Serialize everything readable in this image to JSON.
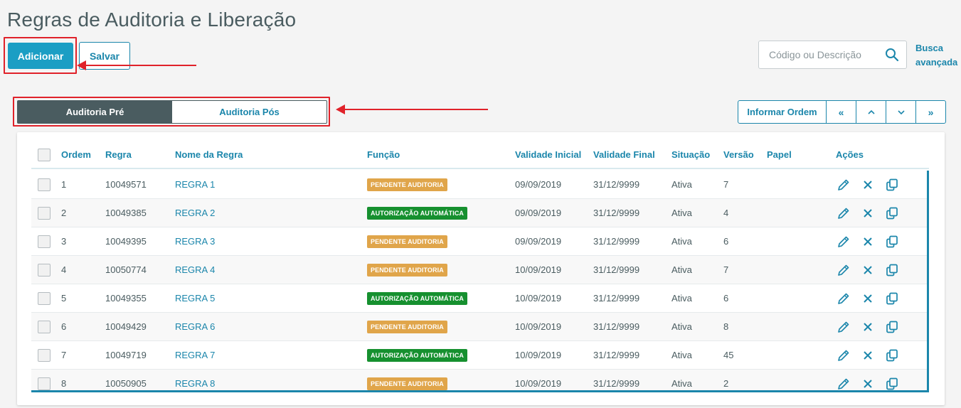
{
  "page": {
    "title": "Regras de Auditoria e Liberação"
  },
  "toolbar": {
    "add_label": "Adicionar",
    "save_label": "Salvar"
  },
  "search": {
    "placeholder": "Código ou Descrição",
    "advanced_line1": "Busca",
    "advanced_line2": "avançada"
  },
  "tabs": [
    {
      "label": "Auditoria Pré",
      "active": true
    },
    {
      "label": "Auditoria Pós",
      "active": false
    }
  ],
  "order_bar": {
    "inform_label": "Informar Ordem",
    "first": "«",
    "up": "˄",
    "down": "˅",
    "last": "»"
  },
  "table": {
    "columns": {
      "order": "Ordem",
      "rule": "Regra",
      "name": "Nome da Regra",
      "function": "Função",
      "valid_from": "Validade Inicial",
      "valid_to": "Validade Final",
      "status": "Situação",
      "version": "Versão",
      "role": "Papel",
      "actions": "Ações"
    },
    "rows": [
      {
        "order": "1",
        "rule": "10049571",
        "name": "REGRA 1",
        "function": "PENDENTE AUDITORIA",
        "kind": "orange",
        "valid_from": "09/09/2019",
        "valid_to": "31/12/9999",
        "status": "Ativa",
        "version": "7"
      },
      {
        "order": "2",
        "rule": "10049385",
        "name": "REGRA 2",
        "function": "AUTORIZAÇÃO AUTOMÁTICA",
        "kind": "green",
        "valid_from": "09/09/2019",
        "valid_to": "31/12/9999",
        "status": "Ativa",
        "version": "4"
      },
      {
        "order": "3",
        "rule": "10049395",
        "name": "REGRA 3",
        "function": "PENDENTE AUDITORIA",
        "kind": "orange",
        "valid_from": "09/09/2019",
        "valid_to": "31/12/9999",
        "status": "Ativa",
        "version": "6"
      },
      {
        "order": "4",
        "rule": "10050774",
        "name": "REGRA 4",
        "function": "PENDENTE AUDITORIA",
        "kind": "orange",
        "valid_from": "10/09/2019",
        "valid_to": "31/12/9999",
        "status": "Ativa",
        "version": "7"
      },
      {
        "order": "5",
        "rule": "10049355",
        "name": "REGRA 5",
        "function": "AUTORIZAÇÃO AUTOMÁTICA",
        "kind": "green",
        "valid_from": "10/09/2019",
        "valid_to": "31/12/9999",
        "status": "Ativa",
        "version": "6"
      },
      {
        "order": "6",
        "rule": "10049429",
        "name": "REGRA 6",
        "function": "PENDENTE AUDITORIA",
        "kind": "orange",
        "valid_from": "10/09/2019",
        "valid_to": "31/12/9999",
        "status": "Ativa",
        "version": "8"
      },
      {
        "order": "7",
        "rule": "10049719",
        "name": "REGRA 7",
        "function": "AUTORIZAÇÃO AUTOMÁTICA",
        "kind": "green",
        "valid_from": "10/09/2019",
        "valid_to": "31/12/9999",
        "status": "Ativa",
        "version": "45"
      },
      {
        "order": "8",
        "rule": "10050905",
        "name": "REGRA 8",
        "function": "PENDENTE AUDITORIA",
        "kind": "orange",
        "valid_from": "10/09/2019",
        "valid_to": "31/12/9999",
        "status": "Ativa",
        "version": "2"
      }
    ]
  },
  "colors": {
    "primary": "#1b9ec4",
    "link": "#1b86ab",
    "dark": "#4a5c60",
    "pending": "#e0a54a",
    "auto": "#16902f",
    "annotation": "#e0222a"
  },
  "icons": {
    "search": "search-icon",
    "edit": "pencil-icon",
    "delete": "close-icon",
    "copy": "copy-icon"
  }
}
